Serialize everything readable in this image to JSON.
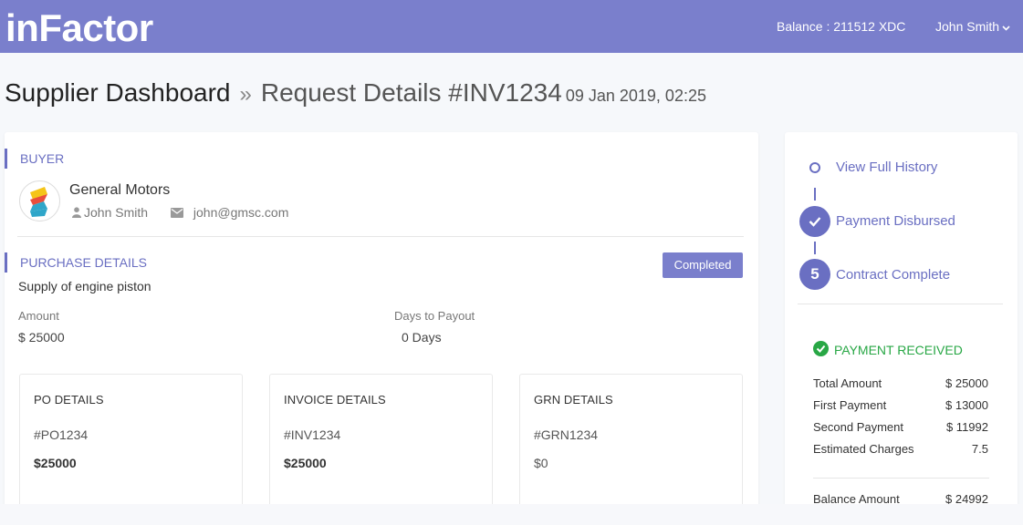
{
  "header": {
    "brand": "inFactor",
    "balance": "Balance : 211512 XDC",
    "user_name": "John Smith",
    "accent_color": "#7a7fcc"
  },
  "breadcrumb": {
    "root": "Supplier Dashboard",
    "separator": "»",
    "current": "Request Details #INV1234",
    "date": "09 Jan 2019, 02:25"
  },
  "buyer": {
    "section_title": "BUYER",
    "company": "General Motors",
    "contact_name": "John Smith",
    "email": "john@gmsc.com",
    "person_icon": "user-icon",
    "email_icon": "envelope-icon"
  },
  "purchase": {
    "section_title": "PURCHASE DETAILS",
    "status": "Completed",
    "description": "Supply of engine piston",
    "amount_label": "Amount",
    "amount_value": "$ 25000",
    "days_label": "Days to Payout",
    "days_value": "0 Days"
  },
  "details": [
    {
      "title": "PO DETAILS",
      "id": "#PO1234",
      "amount": "$25000"
    },
    {
      "title": "INVOICE DETAILS",
      "id": "#INV1234",
      "amount": "$25000"
    },
    {
      "title": "GRN DETAILS",
      "id": "#GRN1234",
      "amount": "$0"
    }
  ],
  "timeline": {
    "history_link": "View Full History",
    "step1_label": "Payment Disbursed",
    "step1_icon": "check-icon",
    "step2_number": "5",
    "step2_label": "Contract Complete"
  },
  "payment": {
    "title": "PAYMENT RECEIVED",
    "status_color": "#28a745",
    "rows": [
      {
        "label": "Total Amount",
        "value": "$ 25000"
      },
      {
        "label": "First Payment",
        "value": "$ 13000"
      },
      {
        "label": "Second Payment",
        "value": "$ 11992"
      },
      {
        "label": "Estimated Charges",
        "value": "7.5"
      }
    ],
    "balance_label": "Balance Amount",
    "balance_value": "$ 24992"
  }
}
